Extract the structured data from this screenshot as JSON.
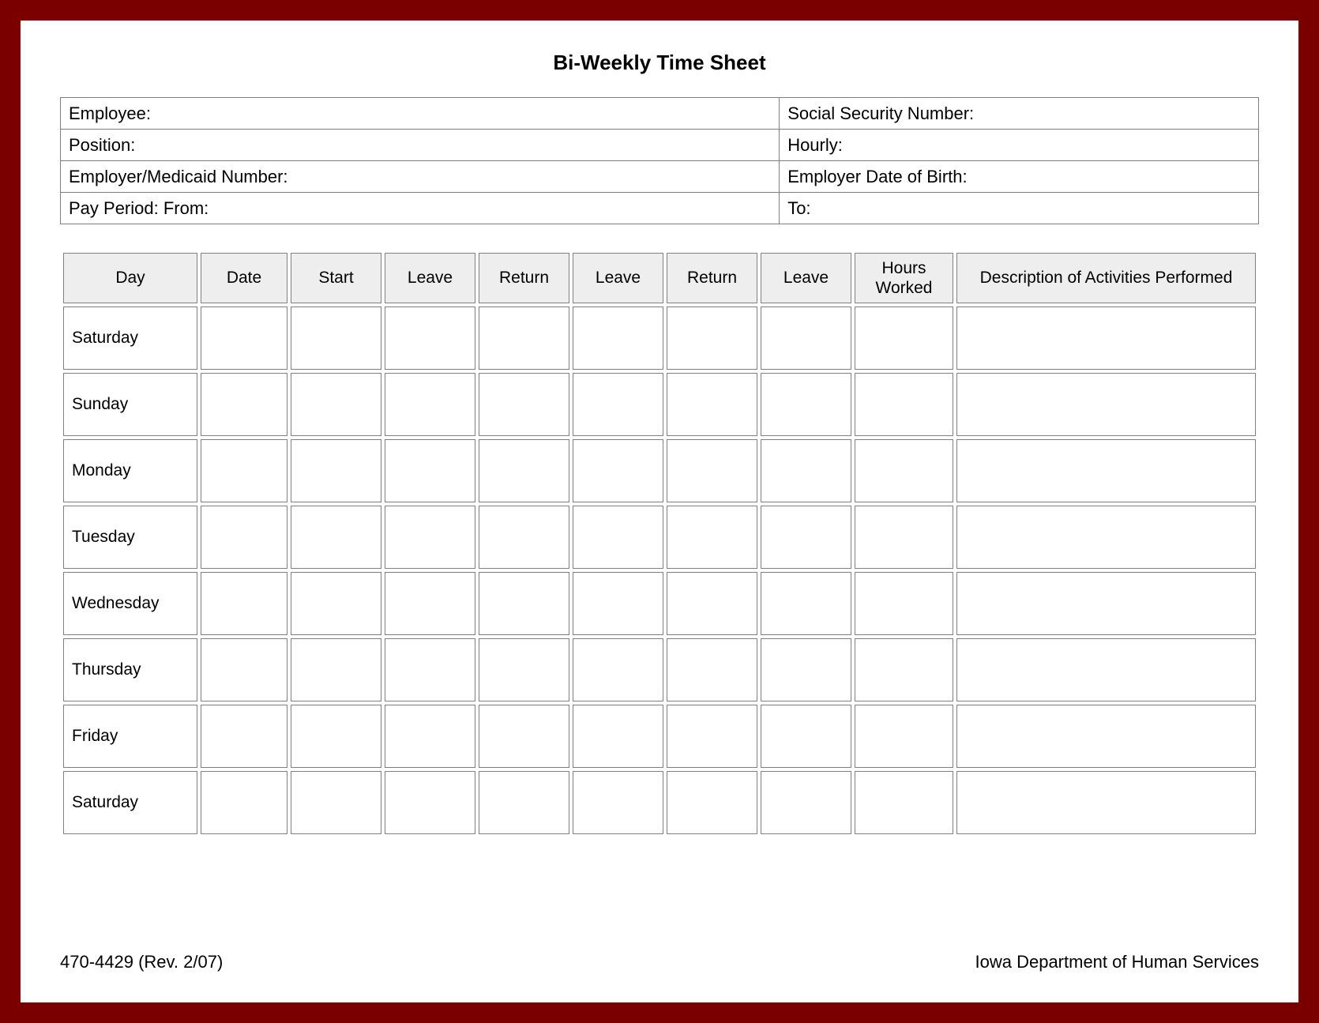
{
  "title": "Bi-Weekly Time Sheet",
  "info": {
    "employee_label": "Employee:",
    "ssn_label": "Social Security Number:",
    "position_label": "Position:",
    "hourly_label": "Hourly:",
    "employer_medicaid_label": "Employer/Medicaid Number:",
    "employer_dob_label": "Employer Date of Birth:",
    "pay_period_from_label": "Pay Period:  From:",
    "pay_period_to_label": "To:"
  },
  "columns": {
    "day": "Day",
    "date": "Date",
    "start": "Start",
    "leave1": "Leave",
    "return1": "Return",
    "leave2": "Leave",
    "return2": "Return",
    "leave3": "Leave",
    "hours": "Hours Worked",
    "desc": "Description of Activities Performed"
  },
  "days": [
    "Saturday",
    "Sunday",
    "Monday",
    "Tuesday",
    "Wednesday",
    "Thursday",
    "Friday",
    "Saturday"
  ],
  "footer": {
    "left": "470-4429  (Rev. 2/07)",
    "right": "Iowa Department of Human Services"
  }
}
